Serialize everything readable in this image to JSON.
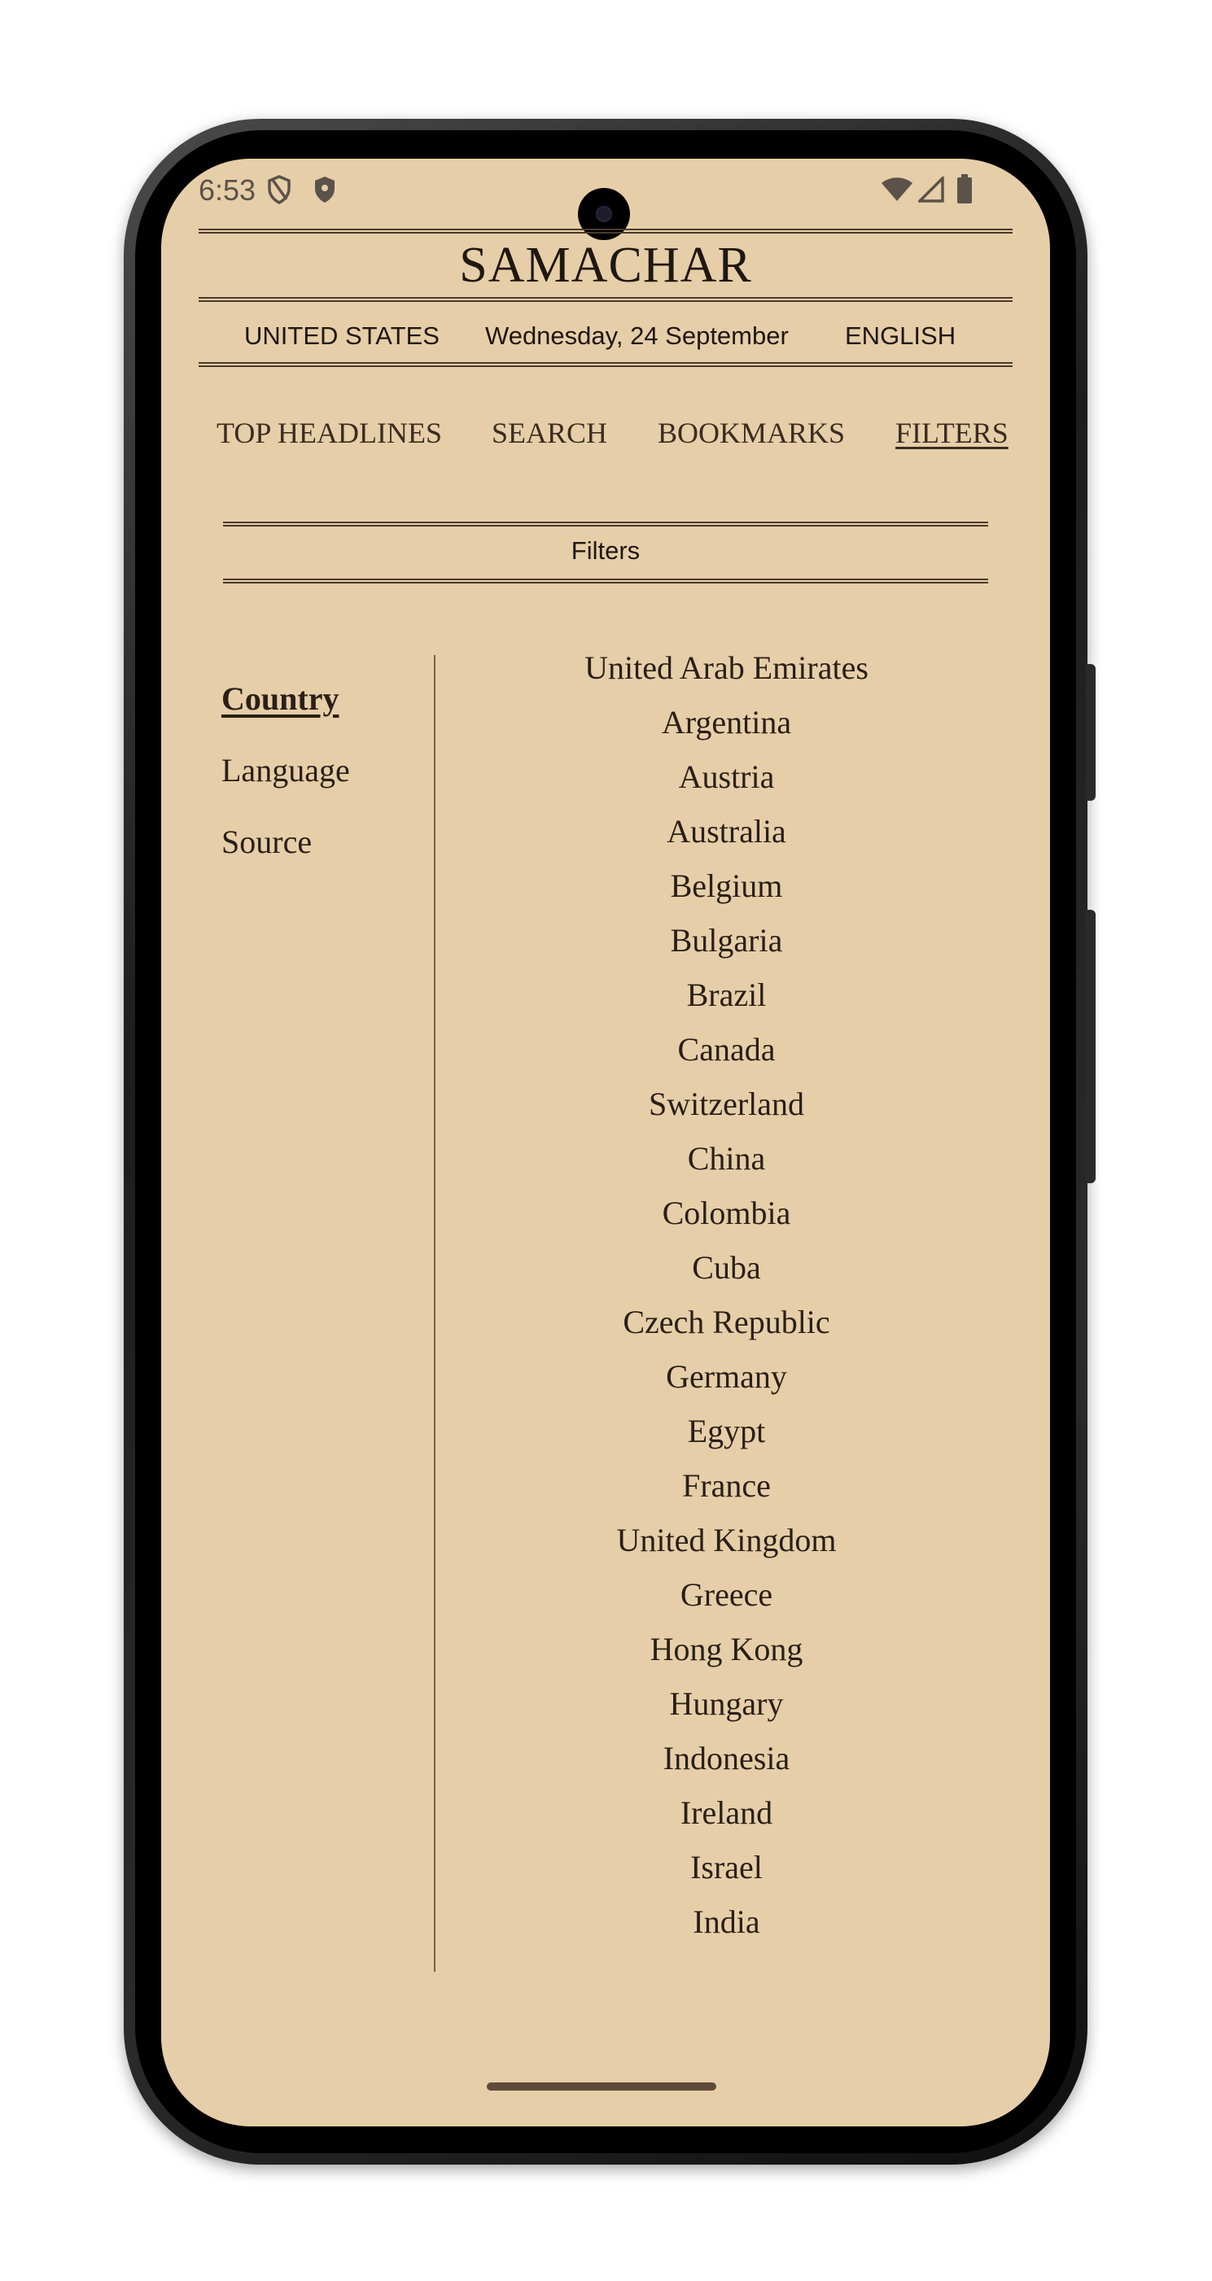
{
  "status_bar": {
    "time": "6:53",
    "left_icons": [
      "shield-outline-icon",
      "shield-filled-icon"
    ],
    "right_icons": [
      "wifi-icon",
      "cellular-signal-icon",
      "battery-icon"
    ]
  },
  "masthead": {
    "title": "SAMACHAR",
    "country": "UNITED STATES",
    "date": "Wednesday, 24 September",
    "language": "ENGLISH"
  },
  "nav": {
    "items": [
      {
        "label": "TOP HEADLINES",
        "active": false
      },
      {
        "label": "SEARCH",
        "active": false
      },
      {
        "label": "BOOKMARKS",
        "active": false
      },
      {
        "label": "FILTERS",
        "active": true
      }
    ]
  },
  "filters": {
    "title": "Filters",
    "categories": [
      {
        "label": "Country",
        "active": true
      },
      {
        "label": "Language",
        "active": false
      },
      {
        "label": "Source",
        "active": false
      }
    ],
    "countries": [
      "United Arab Emirates",
      "Argentina",
      "Austria",
      "Australia",
      "Belgium",
      "Bulgaria",
      "Brazil",
      "Canada",
      "Switzerland",
      "China",
      "Colombia",
      "Cuba",
      "Czech Republic",
      "Germany",
      "Egypt",
      "France",
      "United Kingdom",
      "Greece",
      "Hong Kong",
      "Hungary",
      "Indonesia",
      "Ireland",
      "Israel",
      "India"
    ]
  },
  "colors": {
    "background": "#e6cea8",
    "text": "#2a1f17",
    "rule": "#4a3a2c"
  }
}
